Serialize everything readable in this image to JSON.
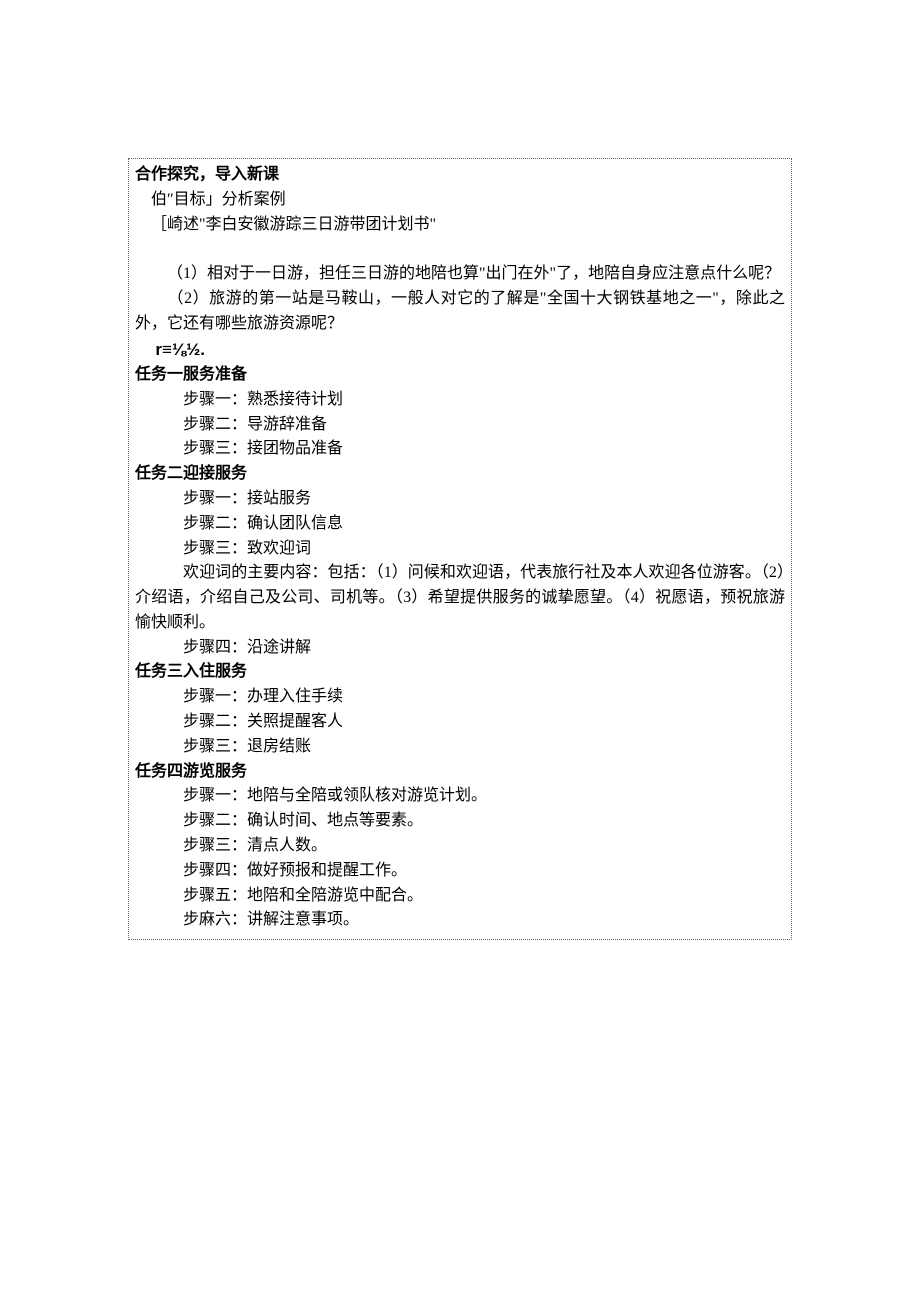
{
  "intro": {
    "title": "合作探究，导入新课",
    "l1": "伯″目标」分析案例",
    "l2": "［崎述\"李白安徽游踪三日游带团计划书\"",
    "q1": "（1）相对于一日游，担任三日游的地陪也算\"出门在外\"了，地陪自身应注意点什么呢？",
    "q2": "（2）旅游的第一站是马鞍山，一般人对它的了解是\"全国十大钢铁基地之一\"，除此之外，它还有哪些旅游资源呢？",
    "formula": "r≡⅛½."
  },
  "task1": {
    "title": "任务一服务准备",
    "s1": "步骤一：熟悉接待计划",
    "s2": "步骤二：导游辞准备",
    "s3": "步骤三：接团物品准备"
  },
  "task2": {
    "title": "任务二迎接服务",
    "s1": "步骤一：接站服务",
    "s2": "步骤二：确认团队信息",
    "s3": "步骤三：致欢迎词",
    "welcome": "欢迎词的主要内容：包括：（1）问候和欢迎语，代表旅行社及本人欢迎各位游客。（2）介绍语，介绍自己及公司、司机等。（3）希望提供服务的诚挚愿望。（4）祝愿语，预祝旅游愉快顺利。",
    "s4": "步骤四：沿途讲解"
  },
  "task3": {
    "title": "任务三入住服务",
    "s1": "步骤一：办理入住手续",
    "s2": "步骤二：关照提醒客人",
    "s3": "步骤三：退房结账"
  },
  "task4": {
    "title": "任务四游览服务",
    "s1": "步骤一：地陪与全陪或领队核对游览计划。",
    "s2": "步骤二：确认时间、地点等要素。",
    "s3": "步骤三：清点人数。",
    "s4": "步骤四：做好预报和提醒工作。",
    "s5": "步骤五：地陪和全陪游览中配合。",
    "s6": "步麻六：讲解注意事项。"
  }
}
